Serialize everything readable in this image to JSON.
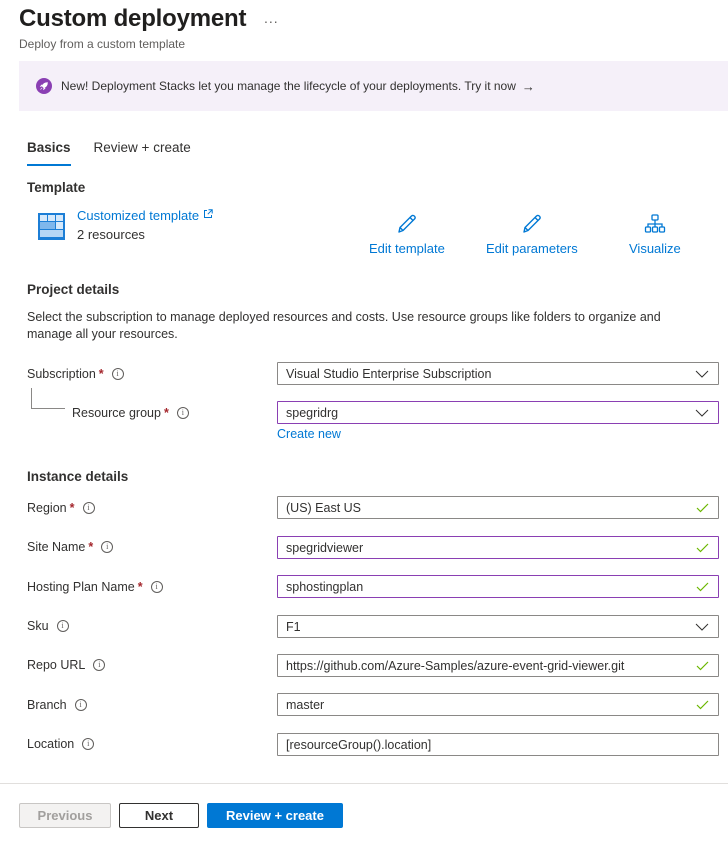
{
  "header": {
    "title": "Custom deployment",
    "more_label": "...",
    "subtitle": "Deploy from a custom template"
  },
  "banner": {
    "icon": "rocket-icon",
    "text": "New! Deployment Stacks let you manage the lifecycle of your deployments. Try it now",
    "arrow": "→"
  },
  "tabs": [
    {
      "label": "Basics",
      "active": true
    },
    {
      "label": "Review + create",
      "active": false
    }
  ],
  "template": {
    "heading": "Template",
    "name": "Customized template",
    "resources": "2 resources",
    "actions": [
      {
        "label": "Edit template",
        "icon": "pencil-icon"
      },
      {
        "label": "Edit parameters",
        "icon": "pencil-icon"
      },
      {
        "label": "Visualize",
        "icon": "hierarchy-icon"
      }
    ]
  },
  "project": {
    "heading": "Project details",
    "description": "Select the subscription to manage deployed resources and costs. Use resource groups like folders to organize and manage all your resources.",
    "subscription": {
      "label": "Subscription",
      "required": true,
      "value": "Visual Studio Enterprise Subscription"
    },
    "resource_group": {
      "label": "Resource group",
      "required": true,
      "value": "spegridrg",
      "create_new": "Create new"
    }
  },
  "instance": {
    "heading": "Instance details",
    "fields": [
      {
        "label": "Region",
        "required": true,
        "value": "(US) East US",
        "valid": true
      },
      {
        "label": "Site Name",
        "required": true,
        "value": "spegridviewer",
        "valid": true
      },
      {
        "label": "Hosting Plan Name",
        "required": true,
        "value": "sphostingplan",
        "valid": true
      },
      {
        "label": "Sku",
        "required": false,
        "value": "F1",
        "dropdown": true
      },
      {
        "label": "Repo URL",
        "required": false,
        "value": "https://github.com/Azure-Samples/azure-event-grid-viewer.git",
        "valid": true
      },
      {
        "label": "Branch",
        "required": false,
        "value": "master",
        "valid": true
      },
      {
        "label": "Location",
        "required": false,
        "value": "[resourceGroup().location]"
      }
    ]
  },
  "footer": {
    "previous": "Previous",
    "next": "Next",
    "review": "Review + create"
  },
  "required_mark": "*",
  "info_glyph": "i",
  "colors": {
    "accent": "#0078d4",
    "focus": "#8a3fb3",
    "valid": "#6bb700",
    "required": "#a4262c"
  }
}
